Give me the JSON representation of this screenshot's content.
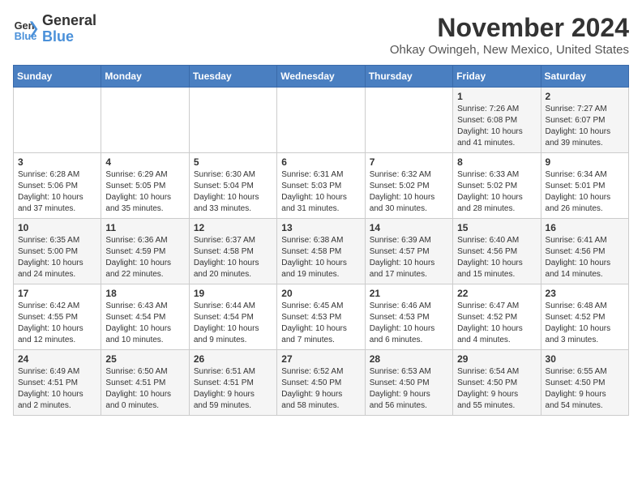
{
  "logo": {
    "line1": "General",
    "line2": "Blue"
  },
  "title": "November 2024",
  "location": "Ohkay Owingeh, New Mexico, United States",
  "weekdays": [
    "Sunday",
    "Monday",
    "Tuesday",
    "Wednesday",
    "Thursday",
    "Friday",
    "Saturday"
  ],
  "weeks": [
    [
      {
        "day": "",
        "info": ""
      },
      {
        "day": "",
        "info": ""
      },
      {
        "day": "",
        "info": ""
      },
      {
        "day": "",
        "info": ""
      },
      {
        "day": "",
        "info": ""
      },
      {
        "day": "1",
        "info": "Sunrise: 7:26 AM\nSunset: 6:08 PM\nDaylight: 10 hours\nand 41 minutes."
      },
      {
        "day": "2",
        "info": "Sunrise: 7:27 AM\nSunset: 6:07 PM\nDaylight: 10 hours\nand 39 minutes."
      }
    ],
    [
      {
        "day": "3",
        "info": "Sunrise: 6:28 AM\nSunset: 5:06 PM\nDaylight: 10 hours\nand 37 minutes."
      },
      {
        "day": "4",
        "info": "Sunrise: 6:29 AM\nSunset: 5:05 PM\nDaylight: 10 hours\nand 35 minutes."
      },
      {
        "day": "5",
        "info": "Sunrise: 6:30 AM\nSunset: 5:04 PM\nDaylight: 10 hours\nand 33 minutes."
      },
      {
        "day": "6",
        "info": "Sunrise: 6:31 AM\nSunset: 5:03 PM\nDaylight: 10 hours\nand 31 minutes."
      },
      {
        "day": "7",
        "info": "Sunrise: 6:32 AM\nSunset: 5:02 PM\nDaylight: 10 hours\nand 30 minutes."
      },
      {
        "day": "8",
        "info": "Sunrise: 6:33 AM\nSunset: 5:02 PM\nDaylight: 10 hours\nand 28 minutes."
      },
      {
        "day": "9",
        "info": "Sunrise: 6:34 AM\nSunset: 5:01 PM\nDaylight: 10 hours\nand 26 minutes."
      }
    ],
    [
      {
        "day": "10",
        "info": "Sunrise: 6:35 AM\nSunset: 5:00 PM\nDaylight: 10 hours\nand 24 minutes."
      },
      {
        "day": "11",
        "info": "Sunrise: 6:36 AM\nSunset: 4:59 PM\nDaylight: 10 hours\nand 22 minutes."
      },
      {
        "day": "12",
        "info": "Sunrise: 6:37 AM\nSunset: 4:58 PM\nDaylight: 10 hours\nand 20 minutes."
      },
      {
        "day": "13",
        "info": "Sunrise: 6:38 AM\nSunset: 4:58 PM\nDaylight: 10 hours\nand 19 minutes."
      },
      {
        "day": "14",
        "info": "Sunrise: 6:39 AM\nSunset: 4:57 PM\nDaylight: 10 hours\nand 17 minutes."
      },
      {
        "day": "15",
        "info": "Sunrise: 6:40 AM\nSunset: 4:56 PM\nDaylight: 10 hours\nand 15 minutes."
      },
      {
        "day": "16",
        "info": "Sunrise: 6:41 AM\nSunset: 4:56 PM\nDaylight: 10 hours\nand 14 minutes."
      }
    ],
    [
      {
        "day": "17",
        "info": "Sunrise: 6:42 AM\nSunset: 4:55 PM\nDaylight: 10 hours\nand 12 minutes."
      },
      {
        "day": "18",
        "info": "Sunrise: 6:43 AM\nSunset: 4:54 PM\nDaylight: 10 hours\nand 10 minutes."
      },
      {
        "day": "19",
        "info": "Sunrise: 6:44 AM\nSunset: 4:54 PM\nDaylight: 10 hours\nand 9 minutes."
      },
      {
        "day": "20",
        "info": "Sunrise: 6:45 AM\nSunset: 4:53 PM\nDaylight: 10 hours\nand 7 minutes."
      },
      {
        "day": "21",
        "info": "Sunrise: 6:46 AM\nSunset: 4:53 PM\nDaylight: 10 hours\nand 6 minutes."
      },
      {
        "day": "22",
        "info": "Sunrise: 6:47 AM\nSunset: 4:52 PM\nDaylight: 10 hours\nand 4 minutes."
      },
      {
        "day": "23",
        "info": "Sunrise: 6:48 AM\nSunset: 4:52 PM\nDaylight: 10 hours\nand 3 minutes."
      }
    ],
    [
      {
        "day": "24",
        "info": "Sunrise: 6:49 AM\nSunset: 4:51 PM\nDaylight: 10 hours\nand 2 minutes."
      },
      {
        "day": "25",
        "info": "Sunrise: 6:50 AM\nSunset: 4:51 PM\nDaylight: 10 hours\nand 0 minutes."
      },
      {
        "day": "26",
        "info": "Sunrise: 6:51 AM\nSunset: 4:51 PM\nDaylight: 9 hours\nand 59 minutes."
      },
      {
        "day": "27",
        "info": "Sunrise: 6:52 AM\nSunset: 4:50 PM\nDaylight: 9 hours\nand 58 minutes."
      },
      {
        "day": "28",
        "info": "Sunrise: 6:53 AM\nSunset: 4:50 PM\nDaylight: 9 hours\nand 56 minutes."
      },
      {
        "day": "29",
        "info": "Sunrise: 6:54 AM\nSunset: 4:50 PM\nDaylight: 9 hours\nand 55 minutes."
      },
      {
        "day": "30",
        "info": "Sunrise: 6:55 AM\nSunset: 4:50 PM\nDaylight: 9 hours\nand 54 minutes."
      }
    ]
  ]
}
